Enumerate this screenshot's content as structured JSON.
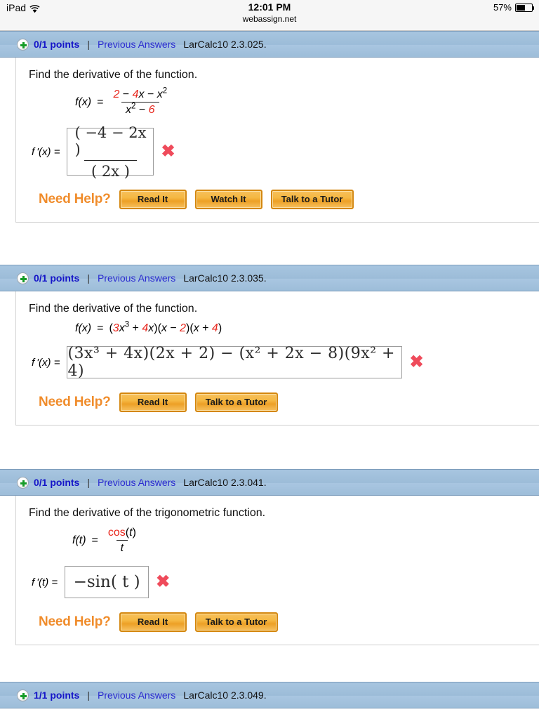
{
  "statusbar": {
    "device": "iPad",
    "wifi_icon": "wifi-icon",
    "time": "12:01 PM",
    "url": "webassign.net",
    "battery_percent": "57%",
    "battery_icon": "battery-icon"
  },
  "theme": {
    "header_blue": "#9cbcd8",
    "link_blue": "#2a2ad0",
    "points_blue": "#1414c8",
    "math_red": "#e8261c",
    "button_orange": "#eda026",
    "need_help_orange": "#f08c2b",
    "x_mark_red": "#ef4b5b",
    "plus_green": "#179c28"
  },
  "questions": [
    {
      "badge_icon": "plus-circle-icon",
      "points": "0/1 points",
      "divider": "|",
      "previous_answers": "Previous Answers",
      "reference": "LarCalc10 2.3.025.",
      "prompt": "Find the derivative of the function.",
      "given": {
        "lhs": "f(x)",
        "equals": "=",
        "numerator": "2 − 4x − x²",
        "denominator": "x² − 6"
      },
      "answer": {
        "label": "f '(x)  =",
        "value": "(−4 − 2x) / (2x)",
        "numerator": "( −4 − 2x )",
        "denominator": "( 2x )",
        "status_icon": "x-mark-icon"
      },
      "help": {
        "label": "Need Help?",
        "buttons": [
          "Read It",
          "Watch It",
          "Talk to a Tutor"
        ]
      }
    },
    {
      "badge_icon": "plus-circle-icon",
      "points": "0/1 points",
      "divider": "|",
      "previous_answers": "Previous Answers",
      "reference": "LarCalc10 2.3.035.",
      "prompt": "Find the derivative of the function.",
      "given": {
        "lhs": "f(x)",
        "equals": "=",
        "expression": "(3x³ + 4x)(x − 2)(x + 4)"
      },
      "answer": {
        "label": "f '(x)  =",
        "value": "(3x³ + 4x)(2x + 2) − (x² + 2x − 8)(9x² + 4)",
        "status_icon": "x-mark-icon"
      },
      "help": {
        "label": "Need Help?",
        "buttons": [
          "Read It",
          "Talk to a Tutor"
        ]
      }
    },
    {
      "badge_icon": "plus-circle-icon",
      "points": "0/1 points",
      "divider": "|",
      "previous_answers": "Previous Answers",
      "reference": "LarCalc10 2.3.041.",
      "prompt": "Find the derivative of the trigonometric function.",
      "given": {
        "lhs": "f(t)",
        "equals": "=",
        "numerator": "cos(t)",
        "denominator": "t"
      },
      "answer": {
        "label": "f '(t)  =",
        "value": "−sin( t )",
        "status_icon": "x-mark-icon"
      },
      "help": {
        "label": "Need Help?",
        "buttons": [
          "Read It",
          "Talk to a Tutor"
        ]
      }
    },
    {
      "badge_icon": "plus-circle-icon",
      "points": "1/1 points",
      "divider": "|",
      "previous_answers": "Previous Answers",
      "reference": "LarCalc10 2.3.049."
    }
  ]
}
